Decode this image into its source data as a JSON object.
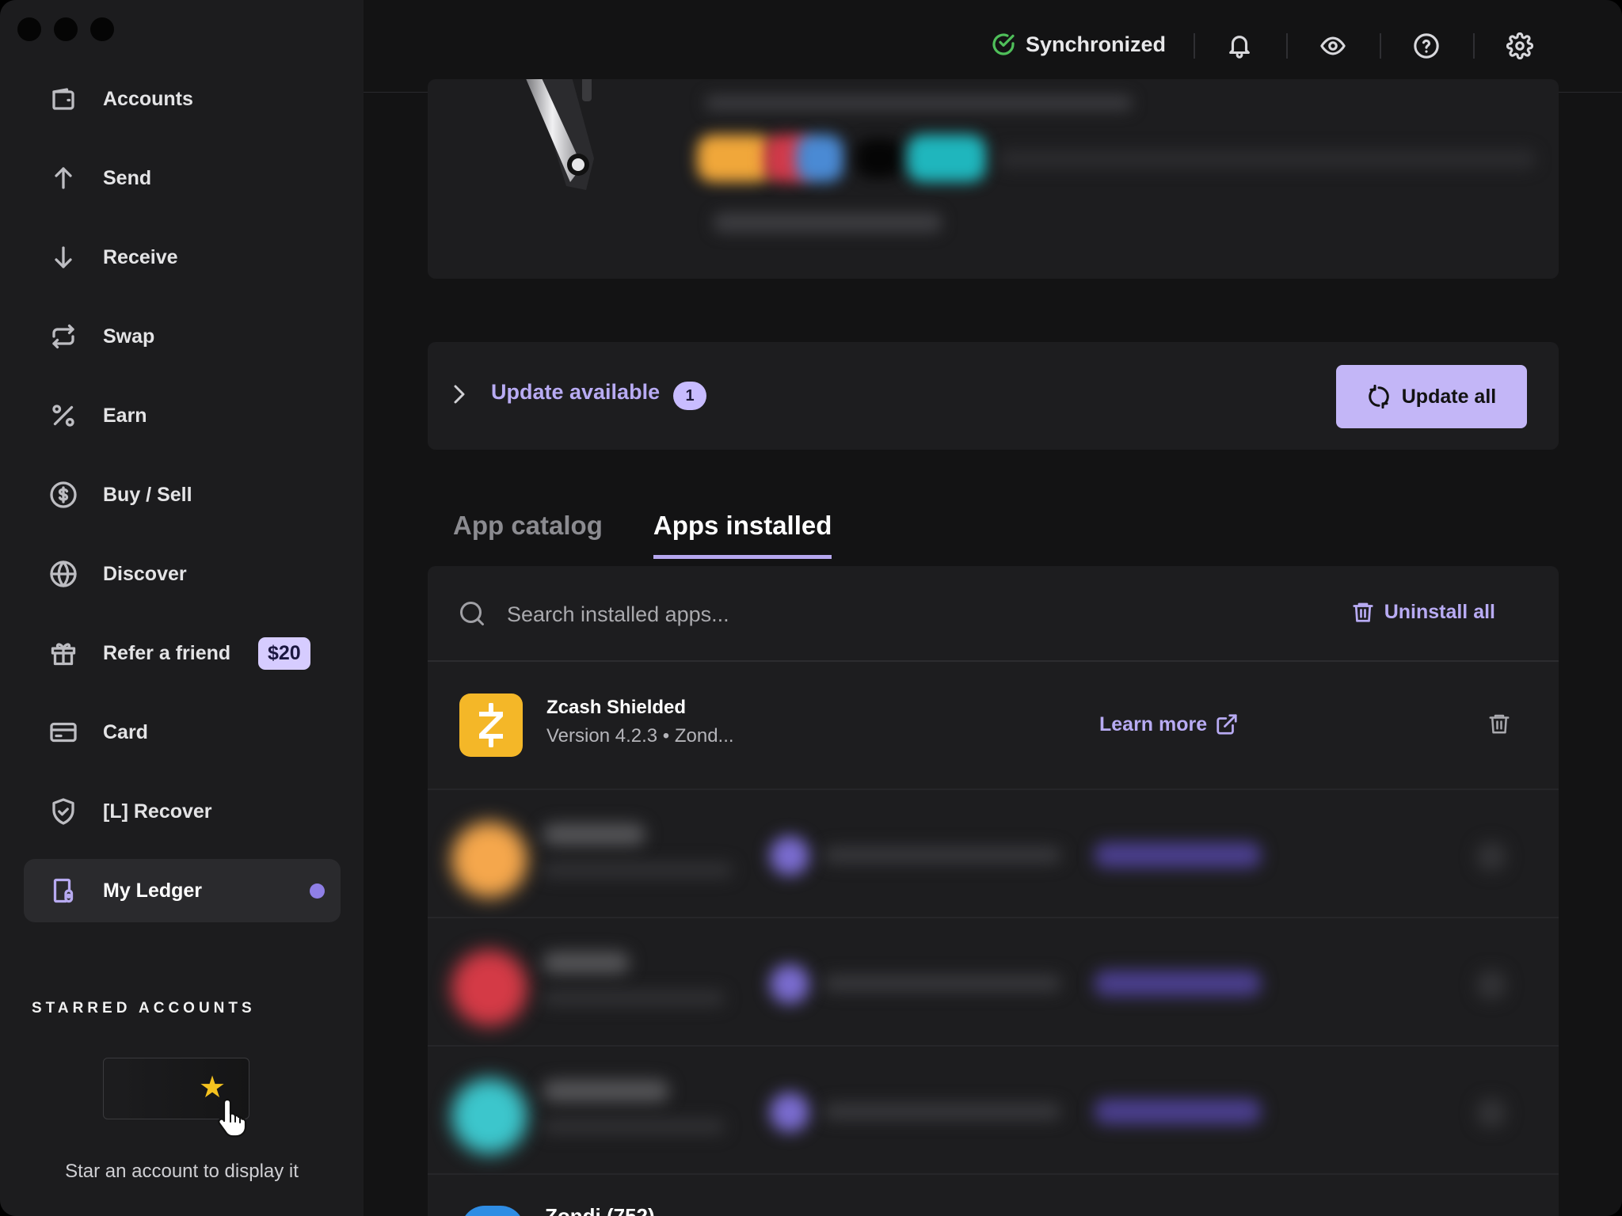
{
  "sidebar": {
    "items": [
      {
        "label": "Accounts",
        "icon": "wallet-icon"
      },
      {
        "label": "Send",
        "icon": "arrow-up-icon"
      },
      {
        "label": "Receive",
        "icon": "arrow-down-icon"
      },
      {
        "label": "Swap",
        "icon": "swap-icon"
      },
      {
        "label": "Earn",
        "icon": "percent-icon"
      },
      {
        "label": "Buy / Sell",
        "icon": "dollar-circle-icon"
      },
      {
        "label": "Discover",
        "icon": "globe-icon"
      },
      {
        "label": "Refer a friend",
        "icon": "gift-icon",
        "badge": "$20"
      },
      {
        "label": "Card",
        "icon": "credit-card-icon"
      },
      {
        "label": "[L] Recover",
        "icon": "shield-check-icon"
      },
      {
        "label": "My Ledger",
        "icon": "ledger-device-icon",
        "active": true
      }
    ],
    "starred_title": "STARRED ACCOUNTS",
    "starred_hint": "Star an account to display it"
  },
  "topbar": {
    "sync_status": "Synchronized",
    "icons": [
      "bell-icon",
      "eye-icon",
      "help-icon",
      "settings-icon"
    ]
  },
  "update": {
    "label": "Update available",
    "count": "1",
    "button": "Update all"
  },
  "tabs": [
    {
      "label": "App catalog",
      "active": false
    },
    {
      "label": "Apps installed",
      "active": true
    }
  ],
  "installed": {
    "search_placeholder": "Search installed apps...",
    "uninstall_all": "Uninstall all",
    "apps": [
      {
        "name": "Zcash Shielded",
        "meta": "Version 4.2.3 • Zond...",
        "learn_more": "Learn more",
        "color": "#f4b728"
      }
    ],
    "peek_name": "Zondi (752)"
  },
  "colors": {
    "accent": "#b8abf3",
    "accent_button": "#c3b6f7",
    "success": "#4fbf5a",
    "sidebar_bg": "#1c1c1e",
    "main_bg": "#131314"
  }
}
